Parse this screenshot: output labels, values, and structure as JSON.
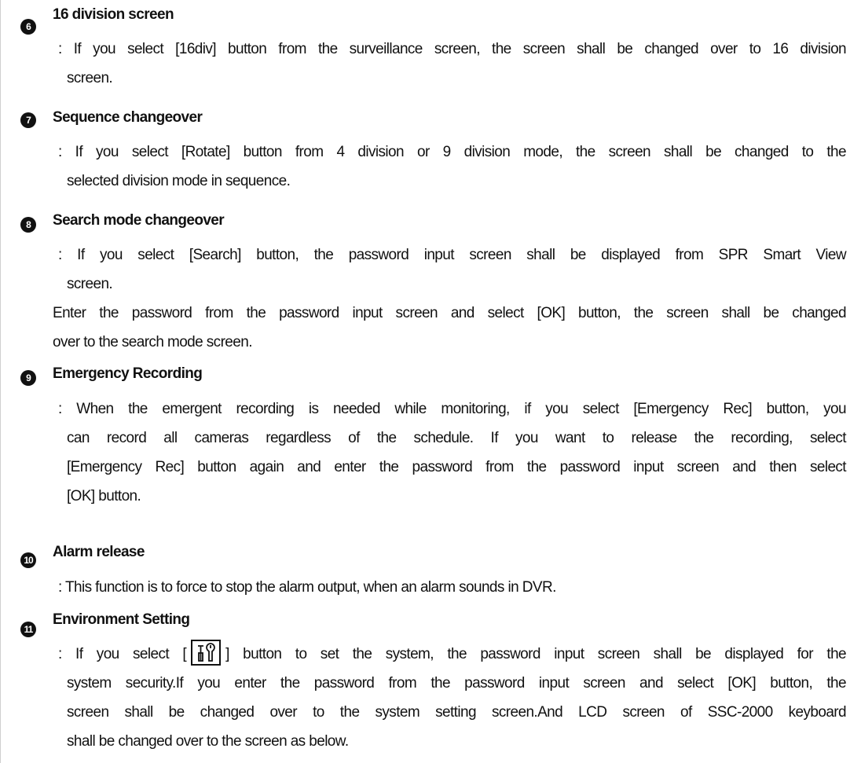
{
  "sections": [
    {
      "number": "6",
      "title": "16 division screen",
      "lines": [
        ": If you select [16div] button from the surveillance screen, the screen shall be changed over to 16 division",
        "screen."
      ]
    },
    {
      "number": "7",
      "title": "Sequence changeover",
      "lines": [
        ": If you select [Rotate] button from 4 division or 9 division mode, the screen shall be changed to the",
        "selected division mode in sequence."
      ]
    },
    {
      "number": "8",
      "title": "Search mode changeover",
      "lines": [
        ": If you select [Search] button, the password input screen shall be displayed from SPR Smart View",
        "screen."
      ],
      "extra_lines": [
        "Enter the password from the password input screen and select [OK] button, the screen shall be changed",
        "over to the search mode screen."
      ]
    },
    {
      "number": "9",
      "title": "Emergency Recording",
      "lines": [
        ": When the emergent recording is needed while monitoring, if you select [Emergency Rec] button, you",
        "can record all cameras regardless of the schedule. If you want to release the recording, select",
        "[Emergency Rec] button again and enter the password from the password input screen and then select",
        "[OK] button."
      ]
    },
    {
      "number": "10",
      "title": "Alarm release",
      "lines": [
        ": This function is to force to stop the alarm output, when an alarm sounds in DVR."
      ]
    },
    {
      "number": "11",
      "title": "Environment Setting",
      "first_line_before_icon": ": If you select [",
      "first_line_after_icon": "] button to set the system, the password input screen shall be displayed for the",
      "icon": "setup-tools-icon",
      "lines": [
        "system security.If you enter the password from the password input screen and select [OK] button, the",
        "screen shall be changed over to the system setting screen.And LCD screen of SSC-2000 keyboard",
        "shall be changed over to the screen as below."
      ]
    }
  ]
}
